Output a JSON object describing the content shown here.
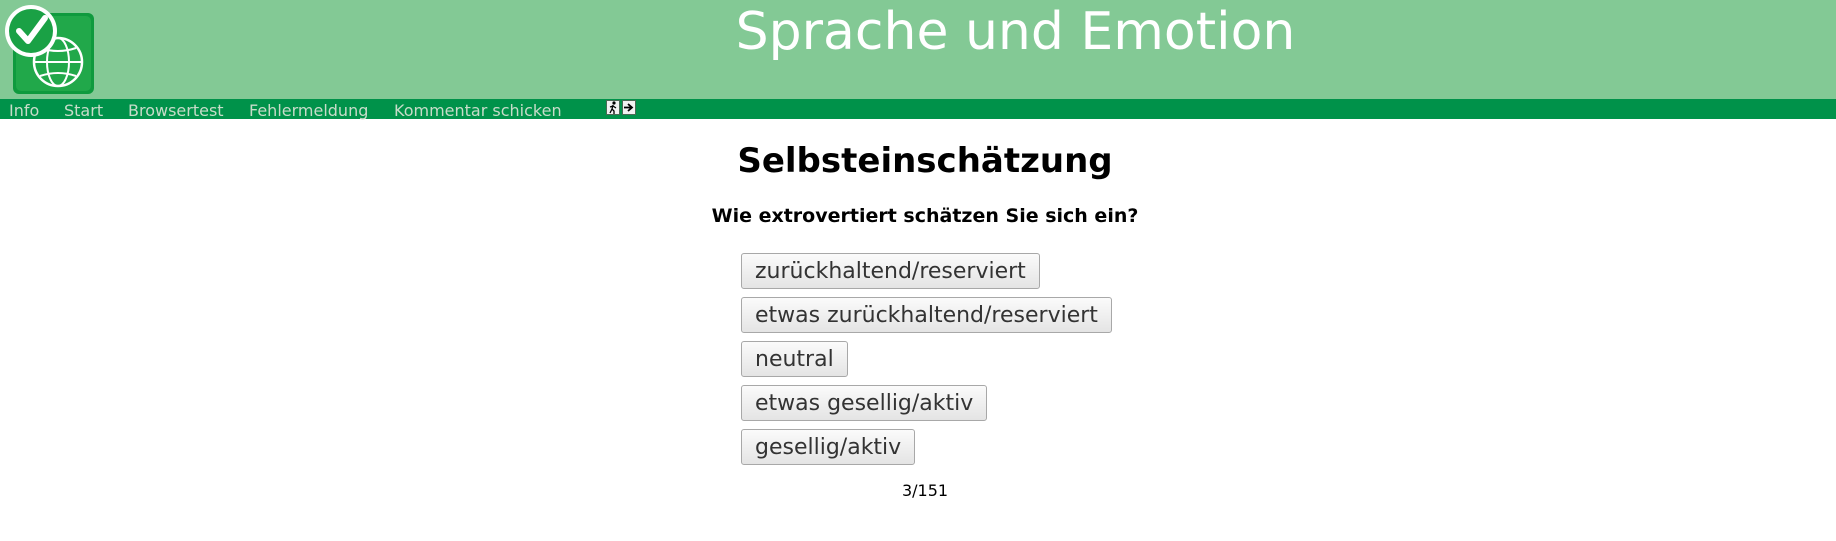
{
  "header": {
    "title": "Sprache und Emotion",
    "logo_icon": "checkmark-globe-logo"
  },
  "nav": {
    "items": [
      "Info",
      "Start",
      "Browsertest",
      "Fehlermeldung",
      "Kommentar schicken"
    ],
    "icons": [
      "exit-icon",
      "arrow-right-icon"
    ]
  },
  "main": {
    "title": "Selbsteinschätzung",
    "question": "Wie extrovertiert schätzen Sie sich ein?",
    "options": [
      "zurückhaltend/reserviert",
      "etwas zurückhaltend/reserviert",
      "neutral",
      "etwas gesellig/aktiv",
      "gesellig/aktiv"
    ],
    "progress": "3/151"
  },
  "colors": {
    "header_bg": "#83c995",
    "navbar_bg": "#00924a",
    "nav_text": "#c7dcc9"
  }
}
